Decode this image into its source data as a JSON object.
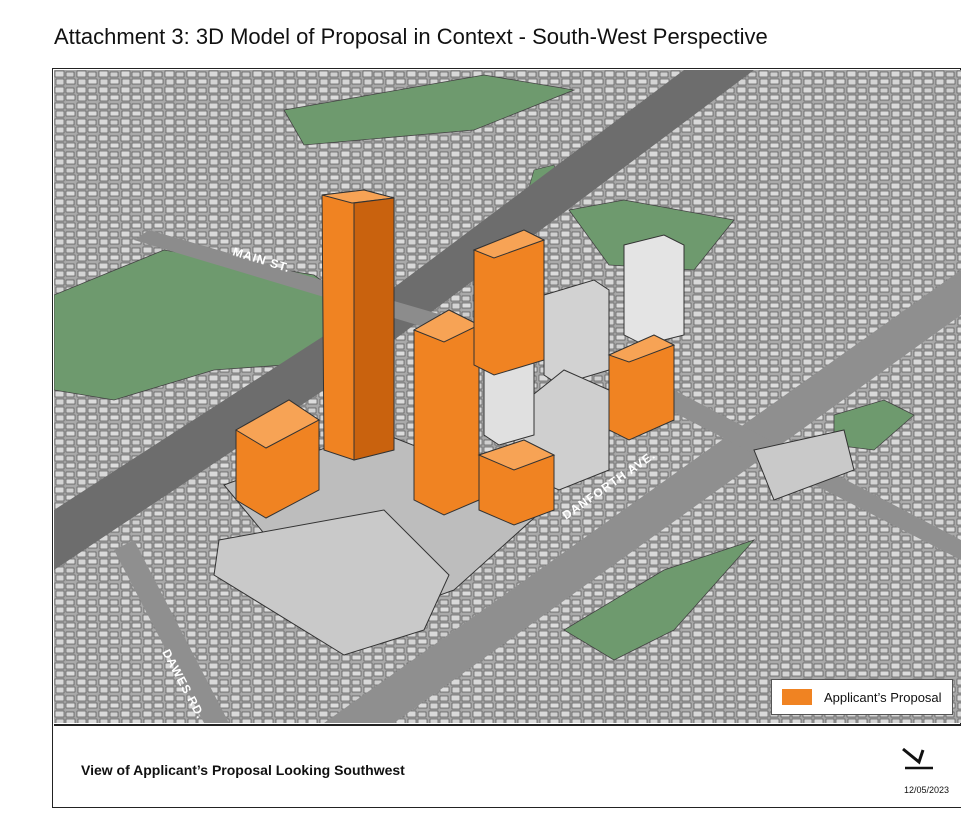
{
  "document": {
    "title": "Attachment 3: 3D Model of Proposal in Context - South-West Perspective"
  },
  "figure": {
    "street_labels": {
      "main": "MAIN ST.",
      "danforth": "DANFORTH AVE.",
      "dawes": "DAWES RD."
    },
    "legend": {
      "label": "Applicant’s Proposal",
      "swatch_color": "#f08322"
    },
    "colors": {
      "proposal": "#f08322",
      "proposal_dark": "#c9620e",
      "park": "#6e9a6e",
      "road": "#6d6d6d",
      "ground": "#b9b9b9",
      "existing_building": "#d6d6d6"
    }
  },
  "caption": {
    "text": "View of Applicant’s Proposal Looking Southwest",
    "date": "12/05/2023",
    "north_arrow_icon": "north-arrow-icon"
  }
}
